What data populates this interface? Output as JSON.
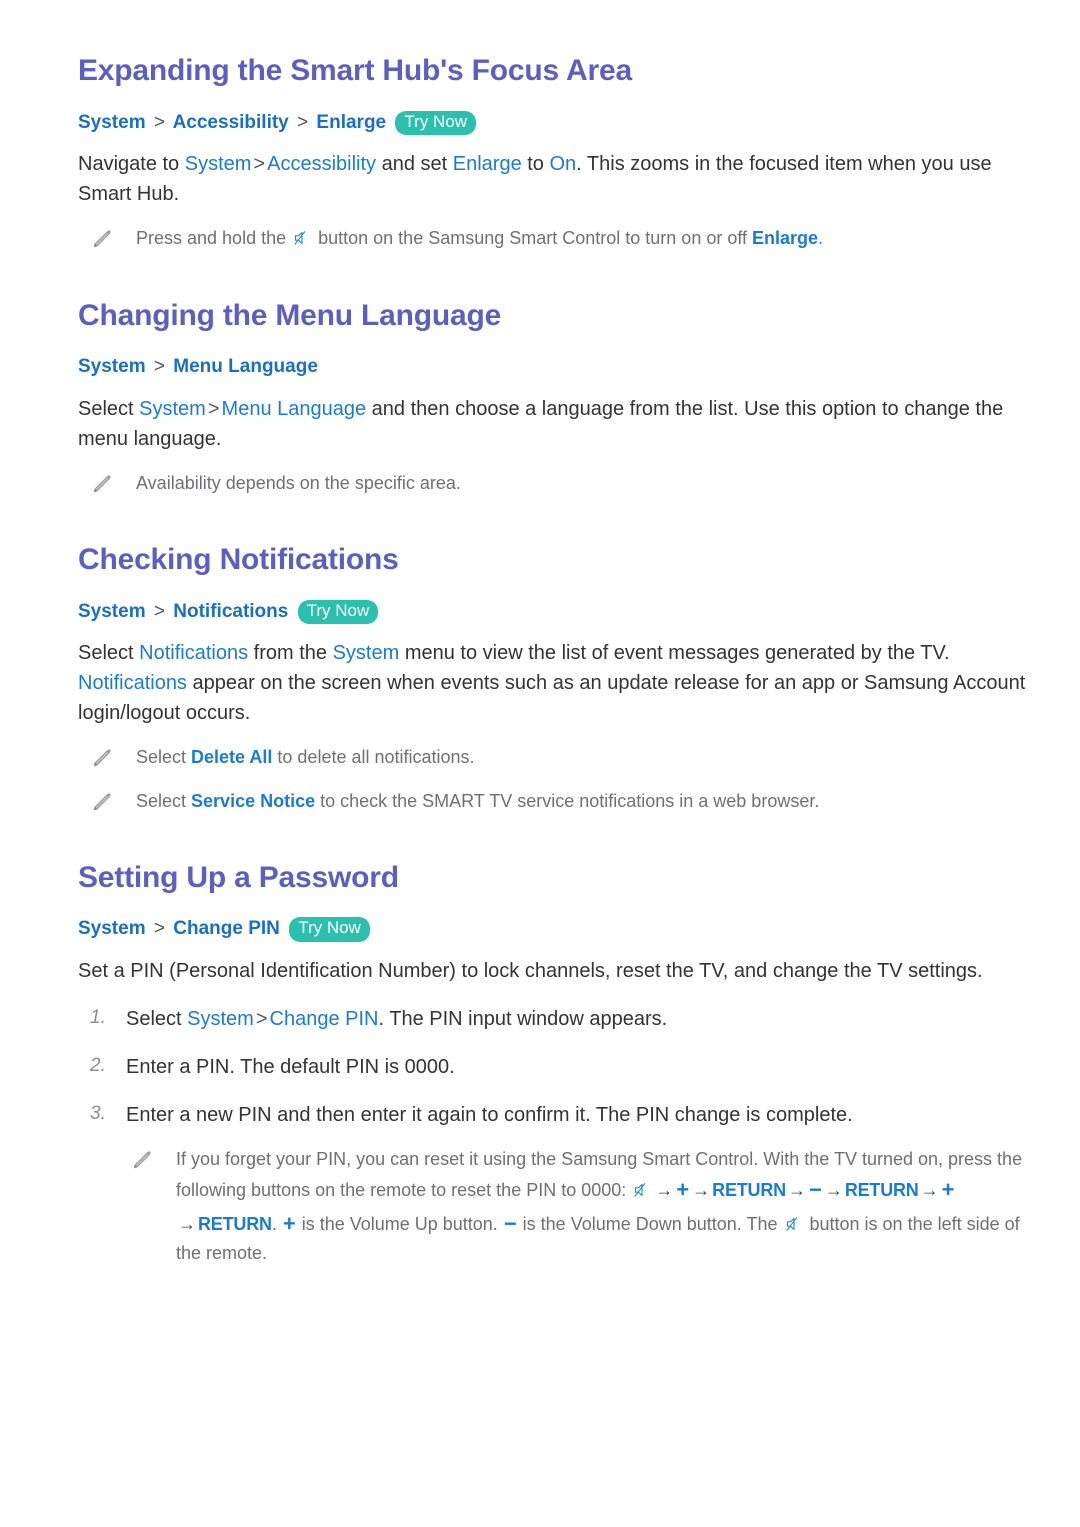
{
  "page": {
    "background": "#ffffff",
    "heading_color": "#5b5fc0",
    "link_color": "#1a7bd4",
    "path_color": "#1a6fc4",
    "badge_color": "#2ac0ad",
    "body_color": "#333333",
    "note_color": "#6f6f72"
  },
  "sections": [
    {
      "title": "Expanding the Smart Hub's Focus Area",
      "path": {
        "items": [
          "System",
          "Accessibility",
          "Enlarge"
        ],
        "separator": ">",
        "badge": "Try Now"
      },
      "body": {
        "p1_a": "Navigate to ",
        "p1_sys": "System",
        "p1_sep": ">",
        "p1_acc": "Accessibility",
        "p1_b": " and set ",
        "p1_enlarge": "Enlarge",
        "p1_c": " to ",
        "p1_on": "On",
        "p1_d": ". This zooms in the focused item when you use Smart Hub."
      },
      "notes": [
        {
          "a": "Press and hold the ",
          "icon": "mute-icon",
          "b": " button on the Samsung Smart Control to turn on or off ",
          "hl": "Enlarge",
          "c": "."
        }
      ]
    },
    {
      "title": "Changing the Menu Language",
      "path": {
        "items": [
          "System",
          "Menu Language"
        ],
        "separator": ">",
        "badge": ""
      },
      "body": {
        "p1_a": "Select ",
        "p1_sys": "System",
        "p1_sep": ">",
        "p1_menu": "Menu Language",
        "p1_b": " and then choose a language from the list. Use this option to change the menu language."
      },
      "notes": [
        {
          "a": "Availability depends on the specific area.",
          "icon": "pencil-icon"
        }
      ]
    },
    {
      "title": "Checking Notifications",
      "path": {
        "items": [
          "System",
          "Notifications"
        ],
        "separator": ">",
        "badge": "Try Now"
      },
      "body": {
        "p1_a": "Select ",
        "p1_notif": "Notifications",
        "p1_b": " from the ",
        "p1_sys": "System",
        "p1_c": " menu to view the list of event messages generated by the TV. ",
        "p1_notif2": "Notifications",
        "p1_d": " appear on the screen when events such as an update release for an app or Samsung Account login/logout occurs."
      },
      "notes": [
        {
          "a": "Select ",
          "hl": "Delete All",
          "b": " to delete all notifications."
        },
        {
          "a": "Select ",
          "hl": "Service Notice",
          "b": " to check the SMART TV service notifications in a web browser."
        }
      ]
    },
    {
      "title": "Setting Up a Password",
      "path": {
        "items": [
          "System",
          "Change PIN"
        ],
        "separator": ">",
        "badge": "Try Now"
      },
      "body": {
        "p1": "Set a PIN (Personal Identification Number) to lock channels, reset the TV, and change the TV settings."
      },
      "steps": [
        {
          "num": "1.",
          "a": "Select ",
          "sys": "System",
          "sep": ">",
          "pin": "Change PIN",
          "b": ". The PIN input window appears."
        },
        {
          "num": "2.",
          "a": "Enter a PIN. The default PIN is 0000."
        },
        {
          "num": "3.",
          "a": "Enter a new PIN and then enter it again to confirm it. The PIN change is complete."
        }
      ],
      "notes": [
        {
          "a": "If you forget your PIN, you can reset it using the Samsung Smart Control. With the TV turned on, press the following buttons on the remote to reset the PIN to 0000: ",
          "seq_arrow": "→",
          "seq_plus": "+",
          "seq_minus": "−",
          "seq_return": "RETURN",
          "b": ". ",
          "c": " is the Volume Up button. ",
          "d": " is the Volume Down button. The ",
          "e": " button is on the left side of the remote."
        }
      ]
    }
  ]
}
